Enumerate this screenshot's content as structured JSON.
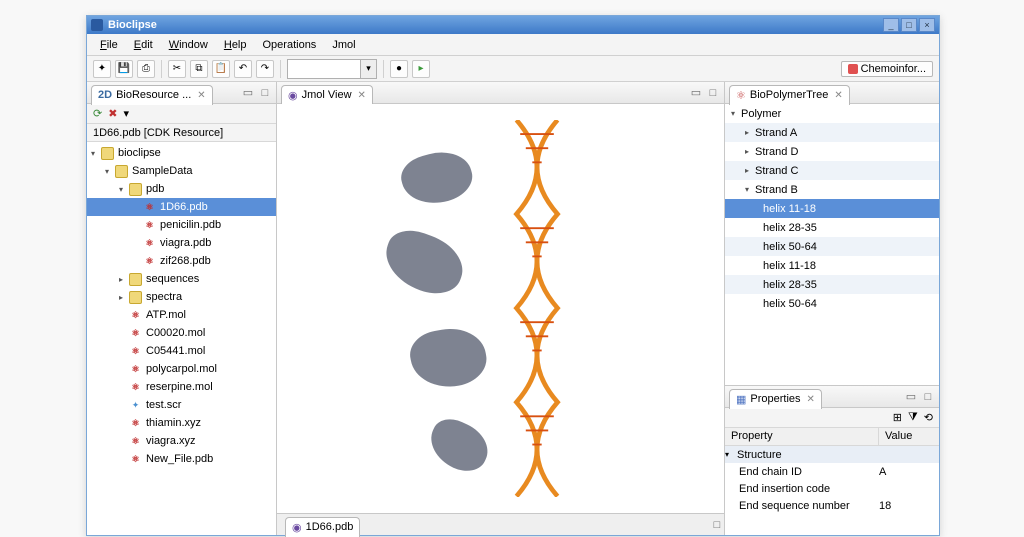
{
  "window": {
    "title": "Bioclipse"
  },
  "menu": [
    "File",
    "Edit",
    "Window",
    "Help",
    "Operations",
    "Jmol"
  ],
  "perspective": "Chemoinfor...",
  "views": {
    "resource": {
      "title": "BioResource ...",
      "crumb": "1D66.pdb  [CDK Resource]"
    },
    "jmol": {
      "title": "Jmol View"
    },
    "polymer": {
      "title": "BioPolymerTree"
    },
    "properties": {
      "title": "Properties"
    },
    "bottom_tab": "1D66.pdb"
  },
  "tree": {
    "root": "bioclipse",
    "sample": "SampleData",
    "pdb": "pdb",
    "pdb_files": [
      "1D66.pdb",
      "penicilin.pdb",
      "viagra.pdb",
      "zif268.pdb"
    ],
    "sequences": "sequences",
    "spectra": "spectra",
    "mols": [
      "ATP.mol",
      "C00020.mol",
      "C05441.mol",
      "polycarpol.mol",
      "reserpine.mol"
    ],
    "scr": "test.scr",
    "extras": [
      "thiamin.xyz",
      "viagra.xyz",
      "New_File.pdb"
    ]
  },
  "polymer": {
    "root": "Polymer",
    "strands": [
      "Strand A",
      "Strand D",
      "Strand C",
      "Strand B"
    ],
    "helices": [
      "helix 11-18",
      "helix 28-35",
      "helix 50-64",
      "helix 11-18",
      "helix 28-35",
      "helix 50-64"
    ]
  },
  "properties": {
    "header": {
      "property": "Property",
      "value": "Value"
    },
    "group": "Structure",
    "rows": [
      {
        "p": "End chain ID",
        "v": "A"
      },
      {
        "p": "End insertion code",
        "v": ""
      },
      {
        "p": "End sequence number",
        "v": "18"
      }
    ]
  }
}
